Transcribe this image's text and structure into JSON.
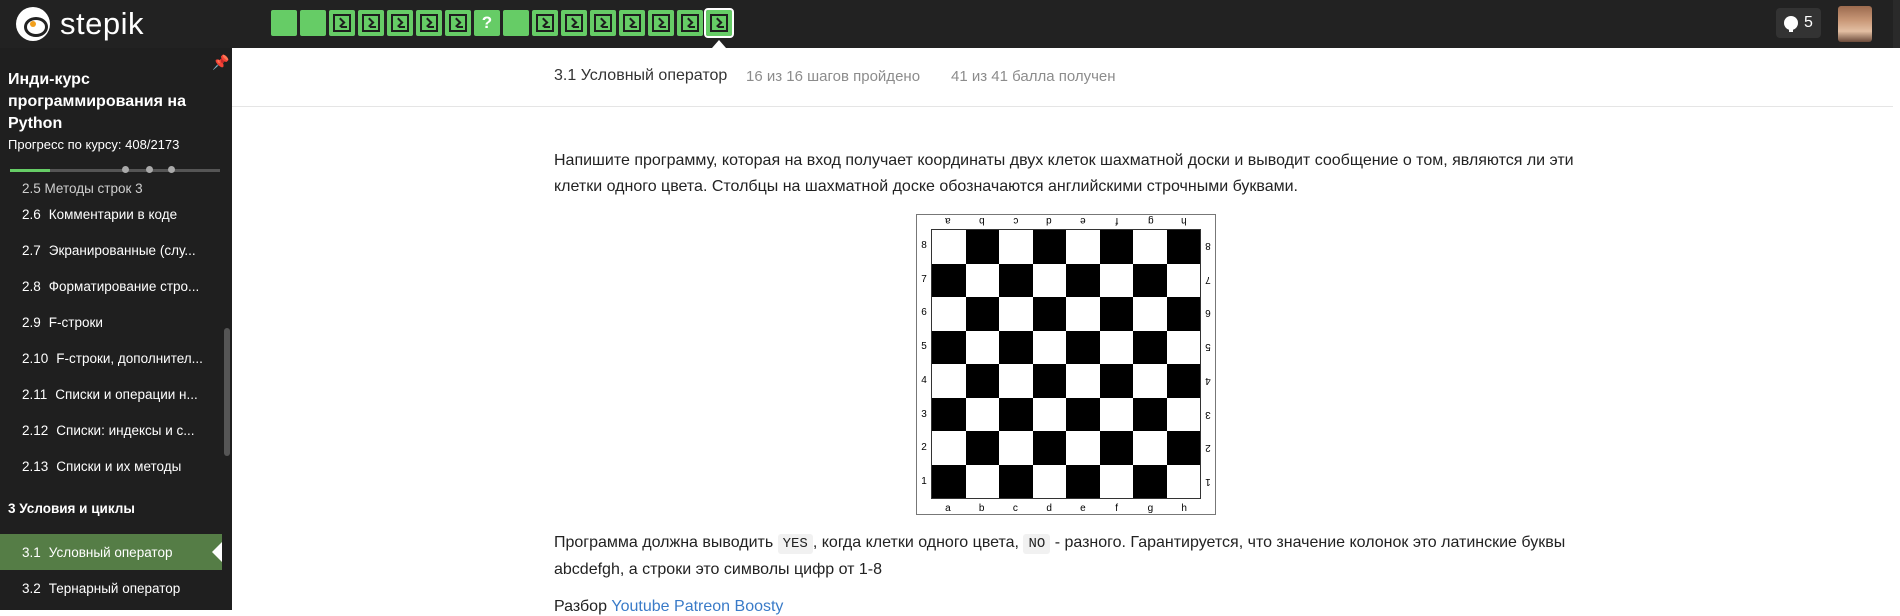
{
  "app": {
    "brand": "stepik"
  },
  "toolbar": {
    "steps": [
      {
        "kind": "filled"
      },
      {
        "kind": "filled"
      },
      {
        "kind": "code"
      },
      {
        "kind": "code"
      },
      {
        "kind": "code"
      },
      {
        "kind": "code"
      },
      {
        "kind": "code"
      },
      {
        "kind": "quiz",
        "label": "?"
      },
      {
        "kind": "filled"
      },
      {
        "kind": "code"
      },
      {
        "kind": "code"
      },
      {
        "kind": "code"
      },
      {
        "kind": "code"
      },
      {
        "kind": "code"
      },
      {
        "kind": "code"
      },
      {
        "kind": "code",
        "current": true
      }
    ],
    "notifications_count": "5",
    "colors": {
      "done": "#66cc66",
      "bar": "#222222"
    }
  },
  "sidebar": {
    "course_title": "Инди-курс программирования на Python",
    "progress_label": "Прогресс по курсу:  408/2173",
    "progress_fraction": 0.19,
    "partial_item": "2.5  Методы строк 3",
    "items": [
      {
        "num": "2.6",
        "label": "Комментарии в коде"
      },
      {
        "num": "2.7",
        "label": "Экранированные (слу..."
      },
      {
        "num": "2.8",
        "label": "Форматирование стро..."
      },
      {
        "num": "2.9",
        "label": "F-строки"
      },
      {
        "num": "2.10",
        "label": "F-строки, дополнител..."
      },
      {
        "num": "2.11",
        "label": "Списки и операции н..."
      },
      {
        "num": "2.12",
        "label": "Списки: индексы и с..."
      },
      {
        "num": "2.13",
        "label": "Списки и их методы"
      }
    ],
    "section": "3  Условия и циклы",
    "active_item": {
      "num": "3.1",
      "label": "Условный оператор"
    },
    "next_item": {
      "num": "3.2",
      "label": "Тернарный оператор"
    }
  },
  "lesson": {
    "title": "3.1 Условный оператор",
    "steps_passed": "16 из 16 шагов пройдено",
    "score": "41 из 41 балла  получен"
  },
  "content": {
    "paragraph1": "Напишите программу, которая на вход получает координаты двух клеток шахматной доски и выводит сообщение о том, являются ли эти клетки одного цвета. Столбцы на шахматной доске обозначаются английскими строчными буквами.",
    "paragraph2_before": "Программа должна выводить ",
    "code_yes": "YES",
    "paragraph2_mid": ", когда клетки одного цвета, ",
    "code_no": "NO",
    "paragraph2_after": " - разного. Гарантируется, что значение колонок это латинские буквы abcdefgh, а строки это символы цифр от 1-8",
    "paragraph3_prefix": "Разбор ",
    "links": [
      "Youtube",
      "Patreon",
      "Boosty"
    ]
  },
  "board": {
    "files": [
      "a",
      "b",
      "c",
      "d",
      "e",
      "f",
      "g",
      "h"
    ],
    "ranks": [
      "8",
      "7",
      "6",
      "5",
      "4",
      "3",
      "2",
      "1"
    ]
  }
}
